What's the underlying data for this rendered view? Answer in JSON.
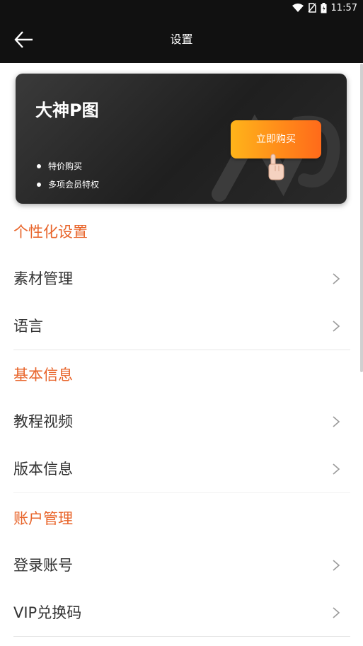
{
  "status_bar": {
    "time": "11:57"
  },
  "header": {
    "title": "设置"
  },
  "banner": {
    "title": "大神P图",
    "buy_label": "立即购买",
    "perks": [
      "特价购买",
      "多项会员特权"
    ]
  },
  "sections": [
    {
      "header": "个性化设置",
      "items": [
        {
          "label": "素材管理"
        },
        {
          "label": "语言"
        }
      ]
    },
    {
      "header": "基本信息",
      "items": [
        {
          "label": "教程视频"
        },
        {
          "label": "版本信息"
        }
      ]
    },
    {
      "header": "账户管理",
      "items": [
        {
          "label": "登录账号"
        },
        {
          "label": "VIP兑换码"
        }
      ]
    }
  ],
  "colors": {
    "accent": "#e8642a",
    "header_bg": "#111111",
    "button_start": "#ffb41a",
    "button_end": "#ff6a1a"
  },
  "icons": [
    "wifi-icon",
    "no-sim-icon",
    "battery-icon",
    "back-arrow-icon",
    "pointing-hand-icon",
    "chevron-right-icon"
  ]
}
